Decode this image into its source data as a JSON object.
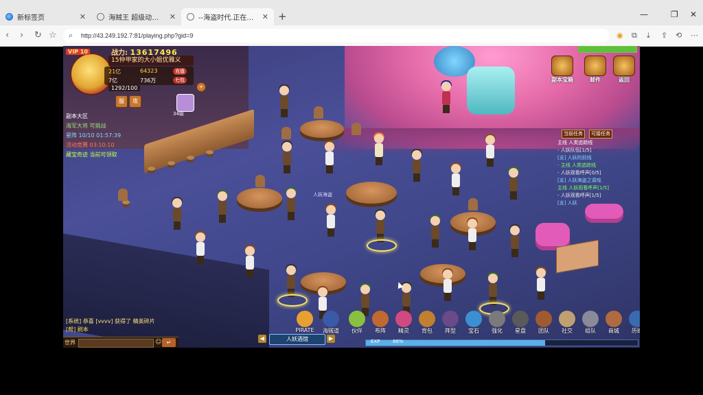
{
  "browser": {
    "tabs": [
      {
        "label": "新标签页",
        "active": false
      },
      {
        "label": "海贼王 超级动漫游戏",
        "active": false
      },
      {
        "label": "--海盗时代.正在游戏--",
        "active": true
      }
    ],
    "url": "http://43.249.192.7:81/playing.php?gid=9",
    "colors": {
      "tab_bar": "#e8e8e8",
      "address_bar": "#f7f7f7"
    }
  },
  "game": {
    "vip": "VIP 10",
    "power_label": "战力:",
    "power_value": "13617496",
    "player_name": "15仲甲家的大小姐优雅义",
    "currencies": {
      "gold": "21亿",
      "ingot": "64323",
      "silver": "7亿",
      "prestige": "736万"
    },
    "recharge_label": "充值",
    "first_charge_label": "七包",
    "energy": "1292/100",
    "pet_level": "34级",
    "quest_panel": {
      "title": "副本大区",
      "lines": [
        "海军大将 可挑战",
        "星阵 10/10 01:57:39",
        "活动竞赛 03:10:10",
        "藏宝奇迹 当前可领取"
      ]
    },
    "tracker": {
      "tabs": [
        "当前任务",
        "可接任务"
      ],
      "lines": [
        "主线 人类追踪线",
        "- 人妖队伍[1/5]",
        "[支] 人妖的前线",
        "- 主线 人类追踪线",
        "- 人妖观看呼声[0/5]",
        "[支] 人妖海盗之调戏",
        "主线 人妖观看呼声[1/5]",
        "- 人妖观看呼声[1/5]",
        "[支] 人妖"
      ]
    },
    "top_buttons": [
      "副本宝箱",
      "邮件",
      "返回"
    ],
    "floating_label": "人妖海盗",
    "chat_lines": [
      "[系统] 恭喜 [vvvv] 获得了 精英碎片",
      "[帮] 刷本"
    ],
    "chat_channel": "世界",
    "map_name": "人妖酒馆",
    "bottom_menu": [
      "PIRATE",
      "海贼道",
      "伙伴",
      "布阵",
      "精灵",
      "背包",
      "阵型",
      "宝石",
      "强化",
      "星盘",
      "团队",
      "社交",
      "组队",
      "商城",
      "历练"
    ],
    "exp_label": "EXP",
    "exp_percent": "66%",
    "exp_fraction": 0.66,
    "hp_fraction": 1.0,
    "colors": {
      "stage_pink": "#e46aa8",
      "floor_blue": "#4a4f98",
      "power_gold": "#ffea4a"
    }
  }
}
